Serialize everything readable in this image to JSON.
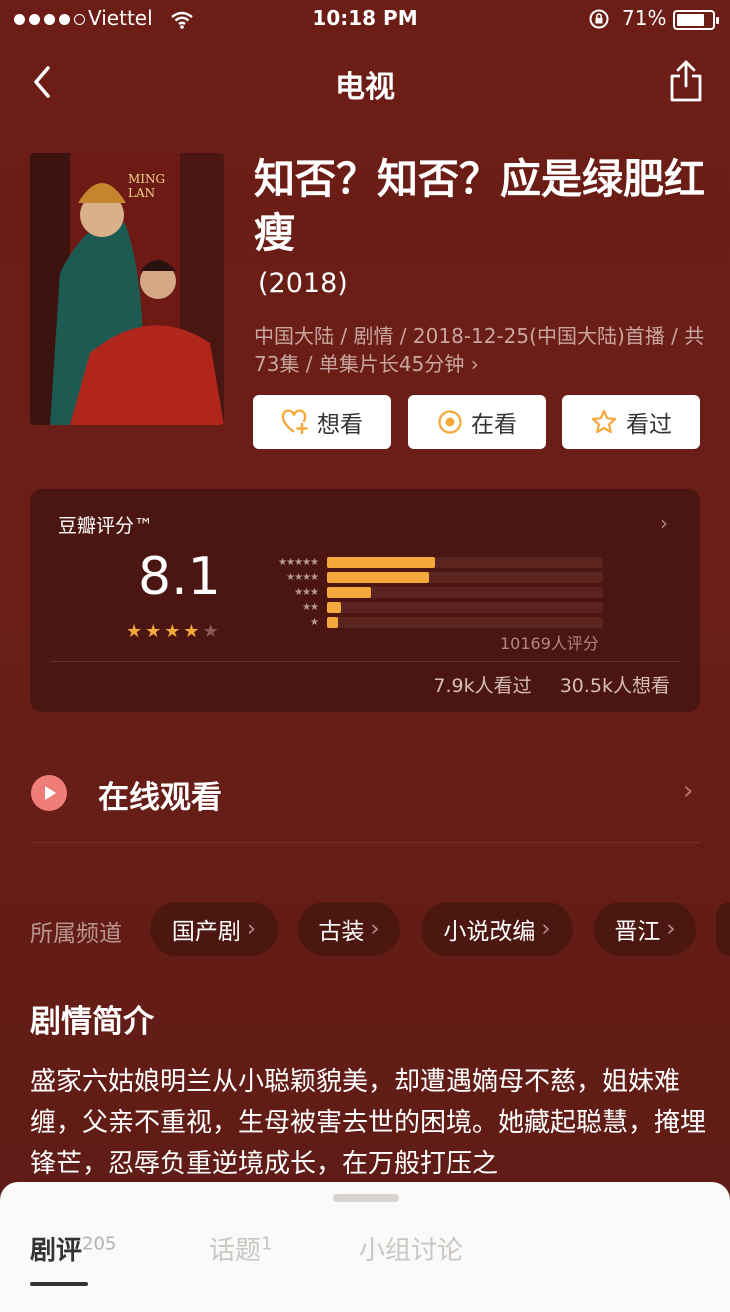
{
  "status_bar": {
    "carrier": "Viettel",
    "time": "10:18 PM",
    "battery": "71%"
  },
  "nav": {
    "title": "电视"
  },
  "show": {
    "title": "知否？知否？应是绿肥红瘦",
    "year": "(2018)",
    "meta": "中国大陆 / 剧情 / 2018-12-25(中国大陆)首播 / 共73集 / 单集片长45分钟 ›",
    "actions": {
      "want": "想看",
      "watching": "在看",
      "watched": "看过"
    }
  },
  "rating": {
    "label": "豆瓣评分™",
    "score": "8.1",
    "star_level": 4,
    "distribution": [
      0.39,
      0.37,
      0.16,
      0.05,
      0.04
    ],
    "votes": "10169人评分",
    "watched": "7.9k人看过",
    "wishlist": "30.5k人想看"
  },
  "online": {
    "label": "在线观看"
  },
  "channels": {
    "label": "所属频道",
    "items": [
      "国产剧",
      "古装",
      "小说改编",
      "晋江"
    ]
  },
  "synopsis": {
    "title": "剧情简介",
    "text": "盛家六姑娘明兰从小聪颖貌美，却遭遇嫡母不慈，姐妹难缠，父亲不重视，生母被害去世的困境。她藏起聪慧，掩埋锋芒，忍辱负重逆境成长，在万般打压之"
  },
  "bottom_tabs": [
    {
      "label": "剧评",
      "count": "205"
    },
    {
      "label": "话题",
      "count": "1"
    },
    {
      "label": "小组讨论",
      "count": ""
    }
  ],
  "colors": {
    "background": "#6b1d16",
    "card": "#4b1611",
    "rating_bar": "#f5a93a",
    "star": "#f5a93a",
    "play_icon": "#f07e78"
  }
}
